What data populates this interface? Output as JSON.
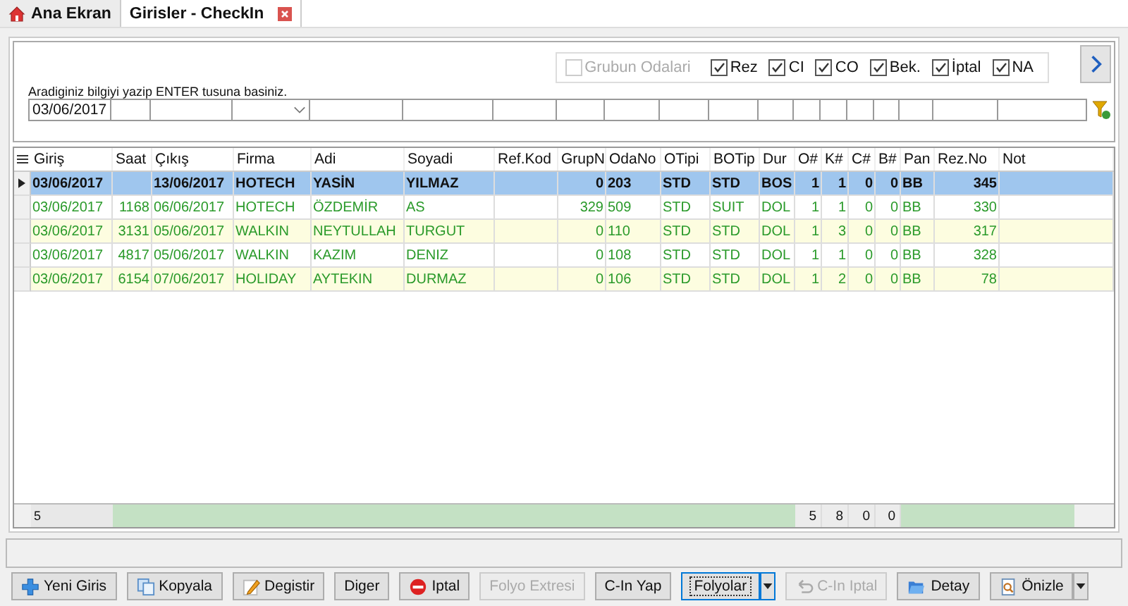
{
  "tabs": [
    {
      "label": "Ana Ekran",
      "selected": false,
      "closable": false
    },
    {
      "label": "Girisler - CheckIn",
      "selected": true,
      "closable": true
    }
  ],
  "filters": {
    "options": [
      {
        "label": "Grubun Odalari",
        "checked": false,
        "disabled": true
      },
      {
        "label": "Rez",
        "checked": true,
        "disabled": false
      },
      {
        "label": "CI",
        "checked": true,
        "disabled": false
      },
      {
        "label": "CO",
        "checked": true,
        "disabled": false
      },
      {
        "label": "Bek.",
        "checked": true,
        "disabled": false
      },
      {
        "label": "İptal",
        "checked": true,
        "disabled": false
      },
      {
        "label": "NA",
        "checked": true,
        "disabled": false
      }
    ],
    "hint": "Aradiginiz bilgiyi yazip ENTER tusuna basiniz.",
    "date_value": "03/06/2017"
  },
  "table": {
    "columns": [
      "Giriş",
      "Saat",
      "Çıkış",
      "Firma",
      "Adi",
      "Soyadi",
      "Ref.Kod",
      "GrupN",
      "OdaNo",
      "OTipi",
      "BOTip",
      "Dur",
      "O#",
      "K#",
      "C#",
      "B#",
      "Pan",
      "Rez.No",
      "Not"
    ],
    "rows": [
      {
        "selected": true,
        "cells": [
          "03/06/2017",
          "",
          "13/06/2017",
          "HOTECH",
          "YASİN",
          "YILMAZ",
          "",
          "0",
          "203",
          "STD",
          "STD",
          "BOS",
          "1",
          "1",
          "0",
          "0",
          "BB",
          "345",
          ""
        ]
      },
      {
        "selected": false,
        "cells": [
          "03/06/2017",
          "1168",
          "06/06/2017",
          "HOTECH",
          "ÖZDEMİR",
          "AS",
          "",
          "329",
          "509",
          "STD",
          "SUIT",
          "DOL",
          "1",
          "1",
          "0",
          "0",
          "BB",
          "330",
          ""
        ]
      },
      {
        "selected": false,
        "cells": [
          "03/06/2017",
          "3131",
          "05/06/2017",
          "WALKIN",
          "NEYTULLAH",
          "TURGUT",
          "",
          "0",
          "110",
          "STD",
          "STD",
          "DOL",
          "1",
          "3",
          "0",
          "0",
          "BB",
          "317",
          ""
        ]
      },
      {
        "selected": false,
        "cells": [
          "03/06/2017",
          "4817",
          "05/06/2017",
          "WALKIN",
          "KAZIM",
          "DENIZ",
          "",
          "0",
          "108",
          "STD",
          "STD",
          "DOL",
          "1",
          "1",
          "0",
          "0",
          "BB",
          "328",
          ""
        ]
      },
      {
        "selected": false,
        "cells": [
          "03/06/2017",
          "6154",
          "07/06/2017",
          "HOLIDAY",
          "AYTEKIN",
          "DURMAZ",
          "",
          "0",
          "106",
          "STD",
          "STD",
          "DOL",
          "1",
          "2",
          "0",
          "0",
          "BB",
          "78",
          ""
        ]
      }
    ],
    "footer": {
      "count": "5",
      "o": "5",
      "k": "8",
      "c": "0",
      "b": "0"
    }
  },
  "buttons": [
    {
      "label": "Yeni Giris",
      "disabled": false,
      "focused": false,
      "split": false
    },
    {
      "label": "Kopyala",
      "disabled": false,
      "focused": false,
      "split": false
    },
    {
      "label": "Degistir",
      "disabled": false,
      "focused": false,
      "split": false
    },
    {
      "label": "Diger",
      "disabled": false,
      "focused": false,
      "split": false
    },
    {
      "label": "Iptal",
      "disabled": false,
      "focused": false,
      "split": false
    },
    {
      "label": "Folyo Extresi",
      "disabled": true,
      "focused": false,
      "split": false
    },
    {
      "label": "C-In Yap",
      "disabled": false,
      "focused": false,
      "split": false
    },
    {
      "label": "Folyolar",
      "disabled": false,
      "focused": true,
      "split": true
    },
    {
      "label": "C-In Iptal",
      "disabled": true,
      "focused": false,
      "split": false
    },
    {
      "label": "Detay",
      "disabled": false,
      "focused": false,
      "split": false
    },
    {
      "label": "Önizle",
      "disabled": false,
      "focused": false,
      "split": true
    }
  ]
}
